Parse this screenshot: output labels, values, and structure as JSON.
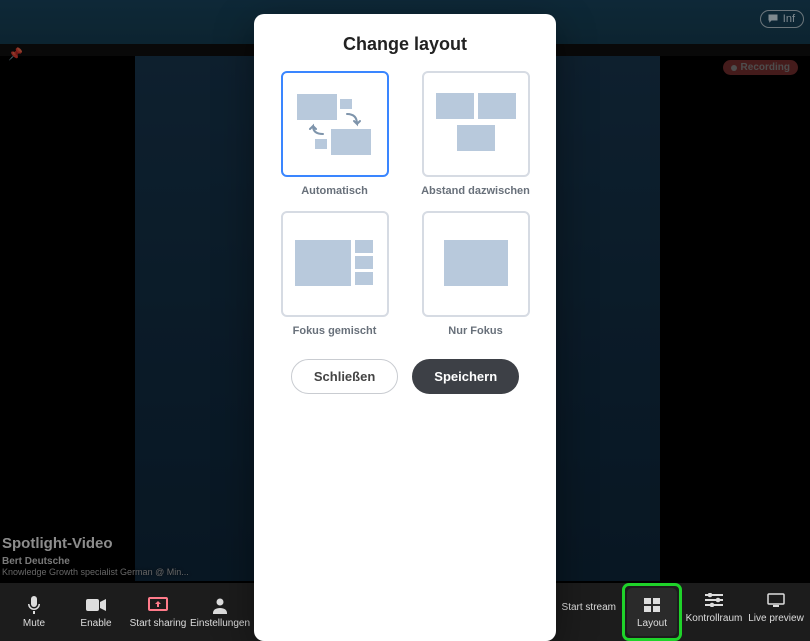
{
  "top": {
    "info_label": "Inf"
  },
  "recording": {
    "label": "Recording"
  },
  "overlay": {
    "title": "Spotlight-Video",
    "name": "Bert Deutsche",
    "role": "Knowledge Growth specialist German @ Min..."
  },
  "toolbar": {
    "mute": "Mute",
    "enable": "Enable",
    "share": "Start sharing",
    "settings": "Einstellungen",
    "start_stream": "Start stream",
    "layout": "Layout",
    "control_room": "Kontrollraum",
    "live_preview": "Live preview"
  },
  "modal": {
    "title": "Change layout",
    "options": {
      "auto": "Automatisch",
      "spaced": "Abstand dazwischen",
      "mixed": "Fokus gemischt",
      "only": "Nur Fokus"
    },
    "close": "Schließen",
    "save": "Speichern"
  }
}
